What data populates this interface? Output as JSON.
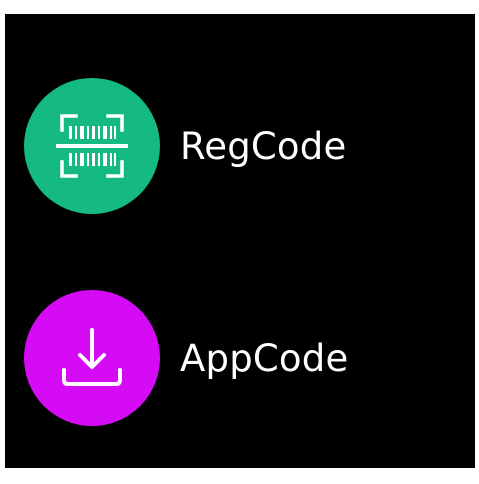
{
  "menu": {
    "items": [
      {
        "id": "regcode",
        "label": "RegCode",
        "icon": "barcode-scan-icon",
        "color": "#15B983"
      },
      {
        "id": "appcode",
        "label": "AppCode",
        "icon": "download-icon",
        "color": "#D60BF5"
      }
    ]
  }
}
